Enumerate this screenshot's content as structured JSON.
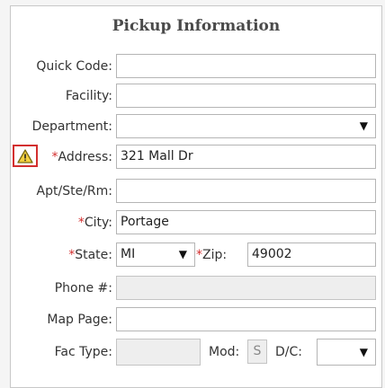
{
  "form": {
    "title": "Pickup Information",
    "required_mark": "*",
    "quick_code": {
      "label": "Quick Code:",
      "value": ""
    },
    "facility": {
      "label": "Facility:",
      "value": ""
    },
    "department": {
      "label": "Department:",
      "value": ""
    },
    "address": {
      "label": "Address:",
      "value": "321 Mall Dr"
    },
    "apt": {
      "label": "Apt/Ste/Rm:",
      "value": ""
    },
    "city": {
      "label": "City:",
      "value": "Portage"
    },
    "state": {
      "label": "State:",
      "value": "MI"
    },
    "zip": {
      "label": "Zip:",
      "value": "49002"
    },
    "phone": {
      "label": "Phone #:",
      "value": ""
    },
    "map_page": {
      "label": "Map Page:",
      "value": ""
    },
    "fac_type": {
      "label": "Fac Type:",
      "value": ""
    },
    "mod": {
      "label": "Mod:",
      "value": "S"
    },
    "dc": {
      "label": "D/C:",
      "value": ""
    }
  },
  "icons": {
    "warning": "warning-triangle-icon",
    "dropdown": "dropdown-arrow-icon"
  },
  "colors": {
    "required": "#d32f2f",
    "warning_fill": "#f4d03f",
    "warning_border": "#d32f2f"
  }
}
